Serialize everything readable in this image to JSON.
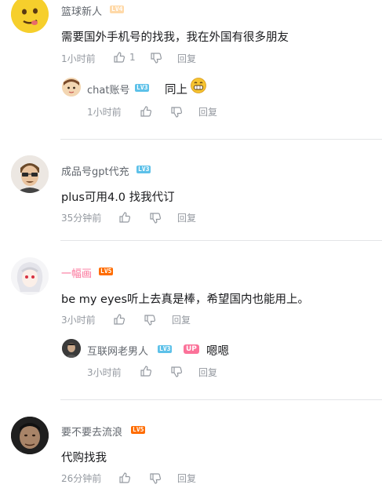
{
  "comments": [
    {
      "user": "篮球新人",
      "level": "LV4",
      "text": "需要国外手机号的找我，我在外国有很多朋友",
      "time": "1小时前",
      "likes": "1",
      "reply_label": "回复",
      "reply": {
        "user": "chat账号",
        "level": "LV3",
        "text": "同上",
        "emoji": "grin-emoji",
        "time": "1小时前",
        "reply_label": "回复"
      }
    },
    {
      "user": "成品号gpt代充",
      "level": "LV3",
      "text": "plus可用4.0 找我代订",
      "time": "35分钟前",
      "reply_label": "回复"
    },
    {
      "user": "一幅画",
      "level": "LV5",
      "text": "be my eyes听上去真是棒，希望国内也能用上。",
      "time": "3小时前",
      "reply_label": "回复",
      "reply": {
        "user": "互联网老男人",
        "level": "LV3",
        "badge": "UP",
        "text": "嗯嗯",
        "time": "3小时前",
        "reply_label": "回复"
      }
    },
    {
      "user": "要不要去流浪",
      "level": "LV5",
      "text": "代购找我",
      "time": "26分钟前",
      "reply_label": "回复"
    }
  ],
  "colors": {
    "pink_name": "#fb7299",
    "meta": "#9499a0",
    "divider": "#e3e5e7"
  }
}
